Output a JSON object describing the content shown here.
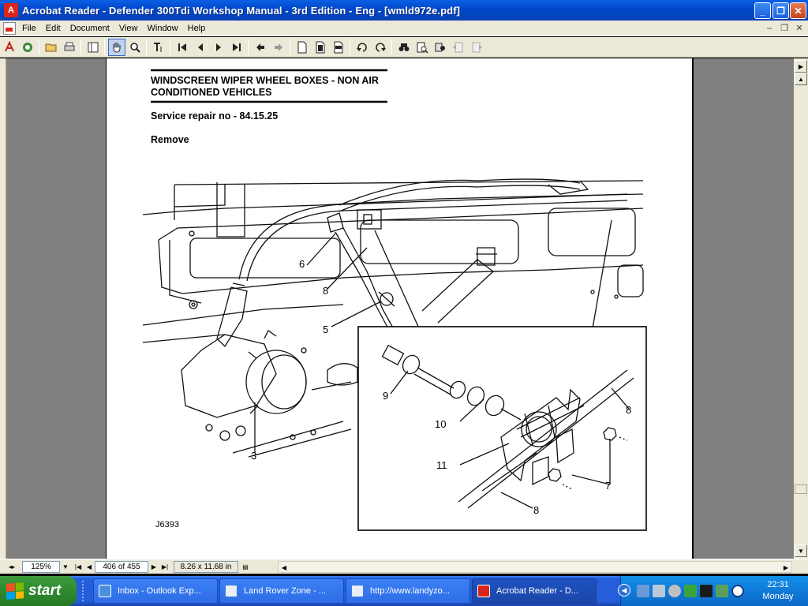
{
  "window": {
    "title": "Acrobat Reader - Defender 300Tdi Workshop Manual - 3rd Edition - Eng - [wmld972e.pdf]",
    "app_icon_letter": "A",
    "min_symbol": "_",
    "restore_symbol": "❐",
    "close_symbol": "✕"
  },
  "menu": {
    "items": [
      "File",
      "Edit",
      "Document",
      "View",
      "Window",
      "Help"
    ],
    "mdi_min": "–",
    "mdi_restore": "❐",
    "mdi_close": "✕"
  },
  "toolbar": {
    "icons": [
      "acrobat-logo-icon",
      "web-capture-icon",
      "open-icon",
      "print-icon",
      "show-navigation-pane-icon",
      "hand-tool-icon",
      "zoom-tool-icon",
      "text-select-tool-icon",
      "first-page-icon",
      "previous-page-icon",
      "next-page-icon",
      "last-page-icon",
      "go-back-icon",
      "go-forward-icon",
      "actual-size-icon",
      "fit-page-icon",
      "fit-width-icon",
      "rotate-counterclockwise-icon",
      "rotate-clockwise-icon",
      "find-icon",
      "search-icon",
      "search-results-icon",
      "previous-highlight-icon",
      "next-highlight-icon"
    ]
  },
  "document": {
    "heading_line1": "WINDSCREEN WIPER WHEEL BOXES - NON AIR",
    "heading_line2": "CONDITIONED VEHICLES",
    "service_repair": "Service repair no - 84.15.25",
    "section": "Remove",
    "figure_id": "J6393",
    "callouts": [
      "6",
      "8",
      "5",
      "3",
      "9",
      "10",
      "11",
      "8",
      "7",
      "8"
    ]
  },
  "statusbar": {
    "zoom": "125%",
    "page": "406 of 455",
    "page_size": "8.26 x 11.68 in"
  },
  "taskbar": {
    "start_label": "start",
    "tasks": [
      {
        "label": "Inbox - Outlook Exp...",
        "color": "#4a8fe0"
      },
      {
        "label": "Land Rover Zone - ...",
        "color": "#3a7bd5"
      },
      {
        "label": "http://www.landyzo...",
        "color": "#3a7bd5"
      },
      {
        "label": "Acrobat Reader - D...",
        "color": "#d9261c"
      }
    ],
    "clock_time": "22:31",
    "clock_day": "Monday"
  },
  "colors": {
    "titlebar": "#0046c8",
    "chrome": "#ece9d8",
    "viewer_bg": "#808080",
    "taskbar": "#245edb",
    "start_green": "#2f8a2f"
  }
}
